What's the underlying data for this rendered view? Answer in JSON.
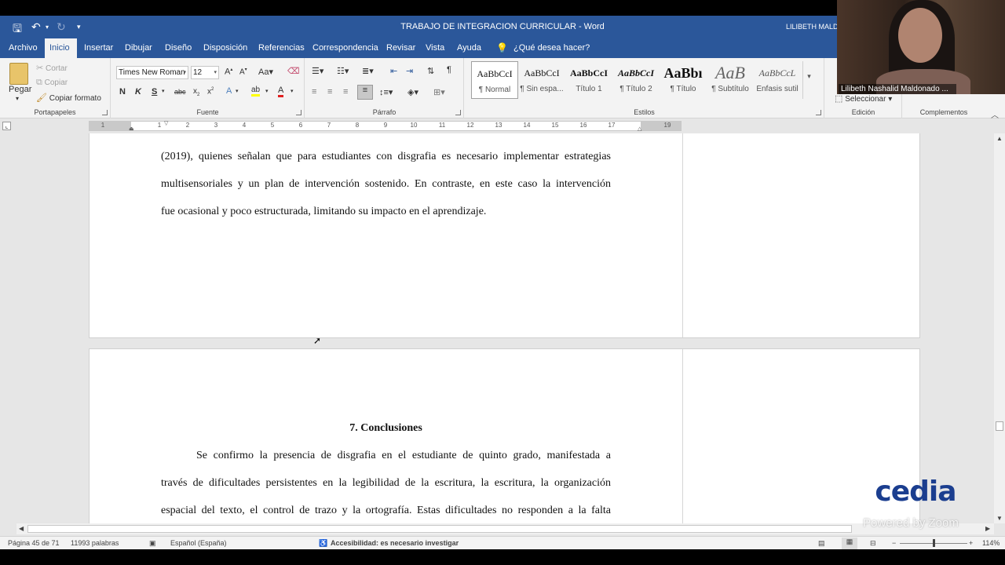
{
  "window": {
    "doc_title": "TRABAJO DE INTEGRACION CURRICULAR  -  Word",
    "user_name": "LILIBETH MALDO"
  },
  "tabs": [
    "Archivo",
    "Inicio",
    "Insertar",
    "Dibujar",
    "Diseño",
    "Disposición",
    "Referencias",
    "Correspondencia",
    "Revisar",
    "Vista",
    "Ayuda"
  ],
  "tell_me": "¿Qué desea hacer?",
  "ribbon": {
    "clipboard": {
      "paste": "Pegar",
      "cut": "Cortar",
      "copy": "Copiar",
      "format_painter": "Copiar formato",
      "label": "Portapapeles"
    },
    "font": {
      "family": "Times New Roman",
      "size": "12",
      "label": "Fuente"
    },
    "paragraph": {
      "label": "Párrafo"
    },
    "styles": {
      "label": "Estilos",
      "items": [
        {
          "preview": "AaBbCcI",
          "name": "¶ Normal"
        },
        {
          "preview": "AaBbCcI",
          "name": "¶ Sin espa..."
        },
        {
          "preview": "AaBbCcI",
          "name": "Título 1"
        },
        {
          "preview": "AaBbCcI",
          "name": "¶ Título 2"
        },
        {
          "preview": "AaBbı",
          "name": "¶ Título"
        },
        {
          "preview": "AaB",
          "name": "¶ Subtítulo"
        },
        {
          "preview": "AaBbCcL",
          "name": "Énfasis sutil"
        }
      ]
    },
    "editing": {
      "select": "Seleccionar",
      "label": "Edición"
    },
    "addins": {
      "label": "Complementos"
    }
  },
  "ruler": {
    "numbers": [
      "1",
      "2",
      "1",
      "2",
      "3",
      "4",
      "5",
      "6",
      "7",
      "8",
      "9",
      "10",
      "11",
      "12",
      "13",
      "14",
      "15",
      "16",
      "17",
      "19"
    ]
  },
  "document": {
    "page1_lines": [
      "(2019), quienes señalan que para estudiantes con disgrafia es necesario implementar estrategias",
      "multisensoriales y un plan de intervención sostenido. En contraste, en este caso la intervención",
      "fue ocasional y poco estructurada, limitando su impacto en el aprendizaje."
    ],
    "heading": "7.   Conclusiones",
    "page2_lines": [
      "Se confirmo la presencia de disgrafia en el estudiante de quinto grado, manifestada a",
      "través de dificultades persistentes en la legibilidad de la escritura, la escritura, la organización",
      "espacial del texto, el control de trazo y la ortografía. Estas dificultades no responden a la falta"
    ]
  },
  "status": {
    "page": "Página 45 de 71",
    "words": "11993 palabras",
    "language": "Español (España)",
    "accessibility": "Accesibilidad: es necesario investigar",
    "zoom": "114%"
  },
  "video": {
    "participant": "Lilibeth Nashalid Maldonado ..."
  },
  "overlay": {
    "logo": "cedia",
    "powered": "Powered by Zoom"
  },
  "colors": {
    "word_blue": "#2b579a",
    "ribbon_bg": "#f3f3f3"
  }
}
